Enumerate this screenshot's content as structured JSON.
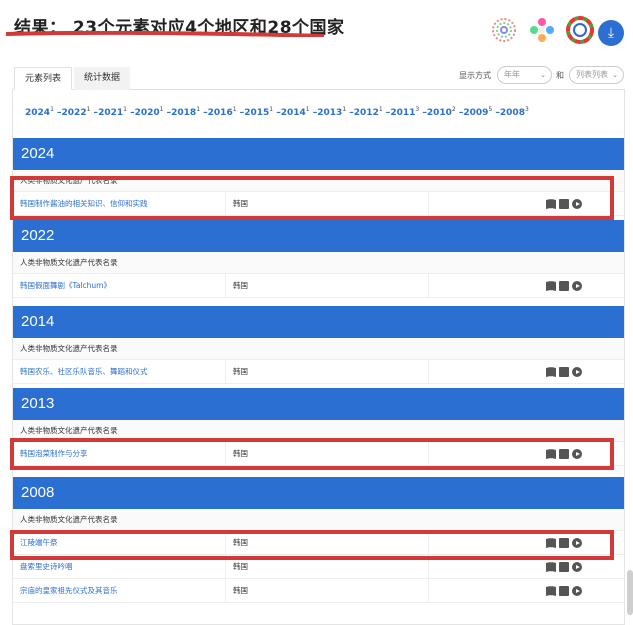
{
  "header": {
    "title": "结果： 23个元素对应4个地区和28个国家",
    "download_label": "⤓"
  },
  "tabs": [
    {
      "label": "元素列表"
    },
    {
      "label": "统计数据"
    }
  ],
  "controls": {
    "view_label": "显示方式",
    "and_label": "和",
    "select_year": "年年",
    "select_list": "列表列表"
  },
  "years_nav": [
    {
      "year": "2024",
      "count": "1"
    },
    {
      "year": "2022",
      "count": "1"
    },
    {
      "year": "2021",
      "count": "1"
    },
    {
      "year": "2020",
      "count": "1"
    },
    {
      "year": "2018",
      "count": "1"
    },
    {
      "year": "2016",
      "count": "1"
    },
    {
      "year": "2015",
      "count": "1"
    },
    {
      "year": "2014",
      "count": "1"
    },
    {
      "year": "2013",
      "count": "1"
    },
    {
      "year": "2012",
      "count": "1"
    },
    {
      "year": "2011",
      "count": "3"
    },
    {
      "year": "2010",
      "count": "2"
    },
    {
      "year": "2009",
      "count": "5"
    },
    {
      "year": "2008",
      "count": "3"
    }
  ],
  "sections": [
    {
      "year": "2024",
      "category": "人类非物质文化遗产代表名录",
      "rows": [
        {
          "name": "韩国制作酱油的相关知识、信仰和实践",
          "country": "韩国"
        }
      ]
    },
    {
      "year": "2022",
      "category": "人类非物质文化遗产代表名录",
      "rows": [
        {
          "name": "韩国假面舞剧《Talchum》",
          "country": "韩国"
        }
      ]
    },
    {
      "year": "2014",
      "category": "人类非物质文化遗产代表名录",
      "rows": [
        {
          "name": "韩国农乐、社区乐队音乐、舞蹈和仪式",
          "country": "韩国"
        }
      ]
    },
    {
      "year": "2013",
      "category": "人类非物质文化遗产代表名录",
      "rows": [
        {
          "name": "韩国泡菜制作与分享",
          "country": "韩国"
        }
      ]
    },
    {
      "year": "2008",
      "category": "人类非物质文化遗产代表名录",
      "rows": [
        {
          "name": "江陵端午祭",
          "country": "韩国"
        },
        {
          "name": "盘索里史诗吟唱",
          "country": "韩国"
        },
        {
          "name": "宗庙的皇家祖先仪式及其音乐",
          "country": "韩国"
        }
      ]
    }
  ]
}
